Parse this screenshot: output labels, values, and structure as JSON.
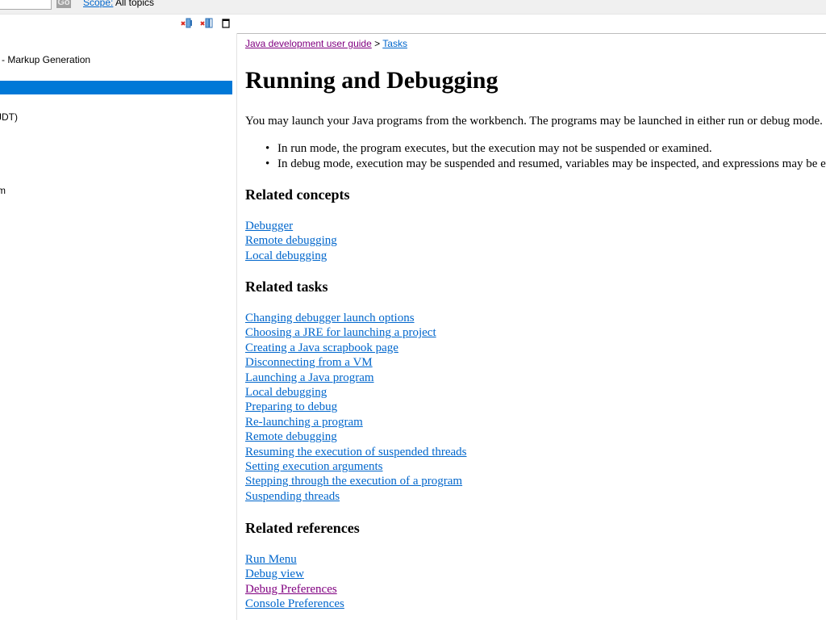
{
  "search": {
    "value": "",
    "go_label": "Go",
    "scope_label": "Scope:",
    "scope_value": "All topics"
  },
  "toolbar": {
    "icons": [
      "remove-all-icon",
      "collapse-icon",
      "maximize-icon"
    ]
  },
  "nav": {
    "items": [
      {
        "label": "- Markup Generation"
      },
      {
        "label": "",
        "selected": true
      },
      {
        "label": "JDT)"
      },
      {
        "label": "m"
      }
    ],
    "selected_color": "#0078d7"
  },
  "content": {
    "breadcrumb": {
      "guide": "Java development user guide",
      "separator": ">",
      "tasks": "Tasks"
    },
    "title": "Running and Debugging",
    "intro": "You may launch your Java programs from the workbench.  The programs may be launched in either run or debug mode.",
    "modes": [
      "In run mode, the program executes, but the execution may not be suspended or examined.",
      "In debug mode, execution may be suspended and resumed, variables may be inspected, and expressions may be evaluated."
    ],
    "related_concepts": {
      "heading": "Related concepts",
      "links": [
        "Debugger",
        "Remote debugging",
        "Local debugging"
      ]
    },
    "related_tasks": {
      "heading": "Related tasks",
      "links": [
        "Changing debugger launch options",
        "Choosing a JRE for launching a project",
        "Creating a Java scrapbook page",
        "Disconnecting from a VM",
        "Launching a Java program",
        "Local debugging",
        "Preparing to debug",
        "Re-launching a program",
        "Remote debugging",
        "Resuming the execution of suspended threads",
        "Setting execution arguments",
        "Stepping through the execution of a program",
        "Suspending threads"
      ]
    },
    "related_references": {
      "heading": "Related references",
      "links": [
        "Run Menu",
        "Debug view",
        "Debug Preferences",
        "Console Preferences"
      ]
    }
  },
  "colors": {
    "link": "#0066cc",
    "visited_link": "#800080"
  }
}
